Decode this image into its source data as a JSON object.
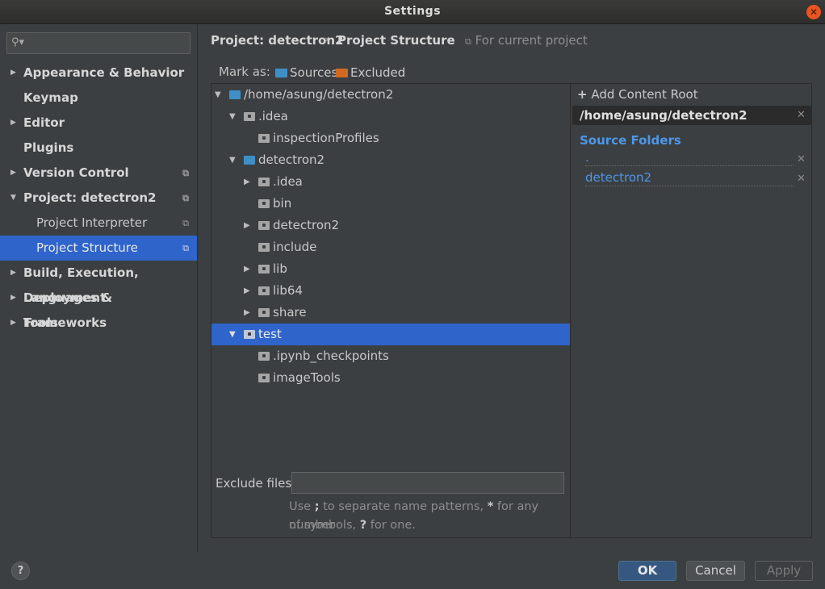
{
  "window": {
    "title": "Settings"
  },
  "sidebar": {
    "search_placeholder": "",
    "items": [
      {
        "label": "Appearance & Behavior"
      },
      {
        "label": "Keymap"
      },
      {
        "label": "Editor"
      },
      {
        "label": "Plugins"
      },
      {
        "label": "Version Control"
      },
      {
        "label": "Project: detectron2"
      },
      {
        "label": "Project Interpreter"
      },
      {
        "label": "Project Structure"
      },
      {
        "label": "Build, Execution, Deployment"
      },
      {
        "label": "Languages & Frameworks"
      },
      {
        "label": "Tools"
      }
    ]
  },
  "header": {
    "crumb_project": "Project: detectron2",
    "crumb_page": "Project Structure",
    "scope": "For current project"
  },
  "mark_as": {
    "label": "Mark as:",
    "sources": "Sources",
    "excluded": "Excluded"
  },
  "tree": {
    "rows": [
      {
        "label": "/home/asung/detectron2"
      },
      {
        "label": ".idea"
      },
      {
        "label": "inspectionProfiles"
      },
      {
        "label": "detectron2"
      },
      {
        "label": ".idea"
      },
      {
        "label": "bin"
      },
      {
        "label": "detectron2"
      },
      {
        "label": "include"
      },
      {
        "label": "lib"
      },
      {
        "label": "lib64"
      },
      {
        "label": "share"
      },
      {
        "label": "test"
      },
      {
        "label": ".ipynb_checkpoints"
      },
      {
        "label": "imageTools"
      }
    ]
  },
  "exclude": {
    "label": "Exclude files:",
    "value": "",
    "hint_1a": "Use ",
    "hint_1b": ";",
    "hint_1c": " to separate name patterns, ",
    "hint_1d": "*",
    "hint_1e": " for any number",
    "hint_2a": "of symbols, ",
    "hint_2b": "?",
    "hint_2c": " for one."
  },
  "content_root": {
    "add_label": "Add Content Root",
    "root_path": "/home/asung/detectron2",
    "source_folders_title": "Source Folders",
    "source_folders": [
      ".",
      "detectron2"
    ]
  },
  "footer": {
    "help": "?",
    "ok": "OK",
    "cancel": "Cancel",
    "apply": "Apply"
  },
  "colors": {
    "accent": "#2f65ca",
    "link": "#4e97e9",
    "sources_folder": "#3f8fc7",
    "excluded_folder": "#d2691e"
  }
}
